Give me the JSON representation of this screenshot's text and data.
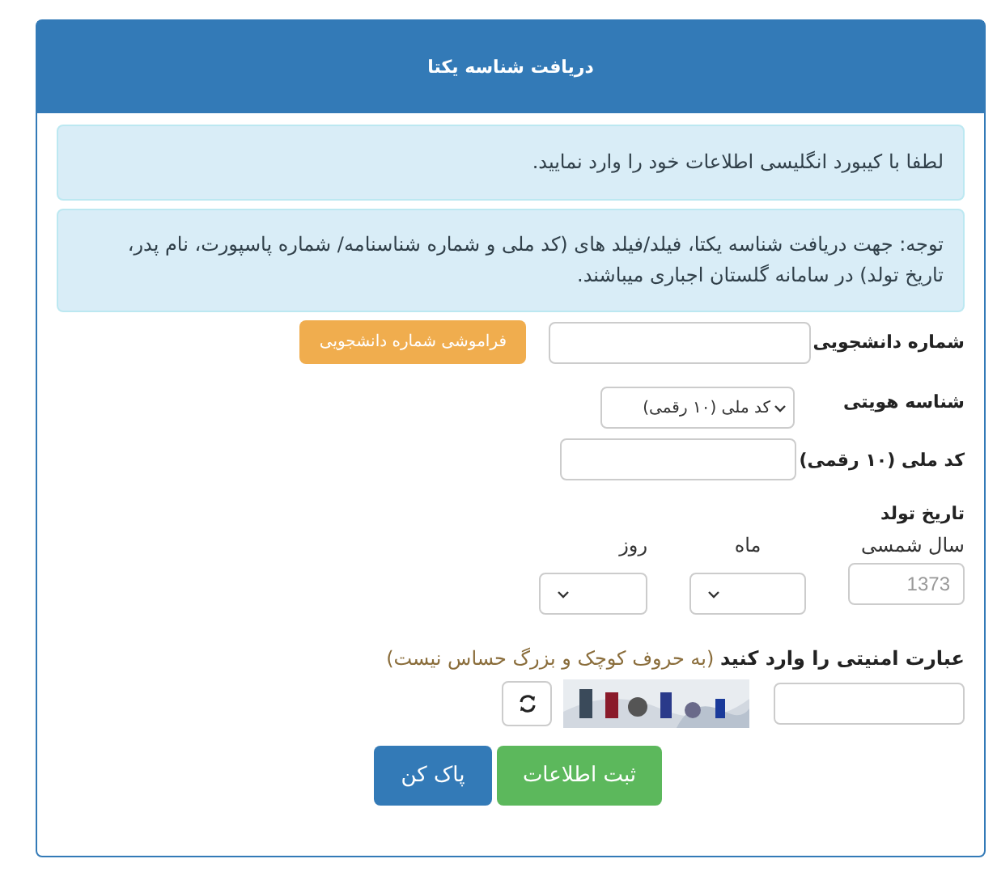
{
  "panel": {
    "title": "دریافت شناسه یکتا"
  },
  "alerts": [
    "لطفا با کیبورد انگلیسی اطلاعات خود را وارد نمایید.",
    "توجه: جهت دریافت شناسه یکتا، فیلد/فیلد های (کد ملی و شماره شناسنامه/ شماره پاسپورت، نام پدر، تاریخ تولد) در سامانه گلستان اجباری میباشند."
  ],
  "student_number": {
    "label": "شماره دانشجویی",
    "forgot_button": "فراموشی شماره دانشجویی"
  },
  "id_type": {
    "label": "شناسه هویتی",
    "value": "کد ملی (۱۰ رقمی)"
  },
  "national_id": {
    "label": "کد ملی (۱۰ رقمی)"
  },
  "birth_date": {
    "label": "تاریخ تولد",
    "year": {
      "label": "سال شمسی",
      "placeholder": "1373"
    },
    "month": {
      "label": "ماه"
    },
    "day": {
      "label": "روز"
    }
  },
  "captcha": {
    "label": "عبارت امنیتی را وارد کنید",
    "hint": "(به حروف کوچک و بزرگ حساس نیست)"
  },
  "buttons": [
    {
      "label": "ثبت اطلاعات",
      "kind": "success"
    },
    {
      "label": "پاک کن",
      "kind": "primary"
    }
  ]
}
